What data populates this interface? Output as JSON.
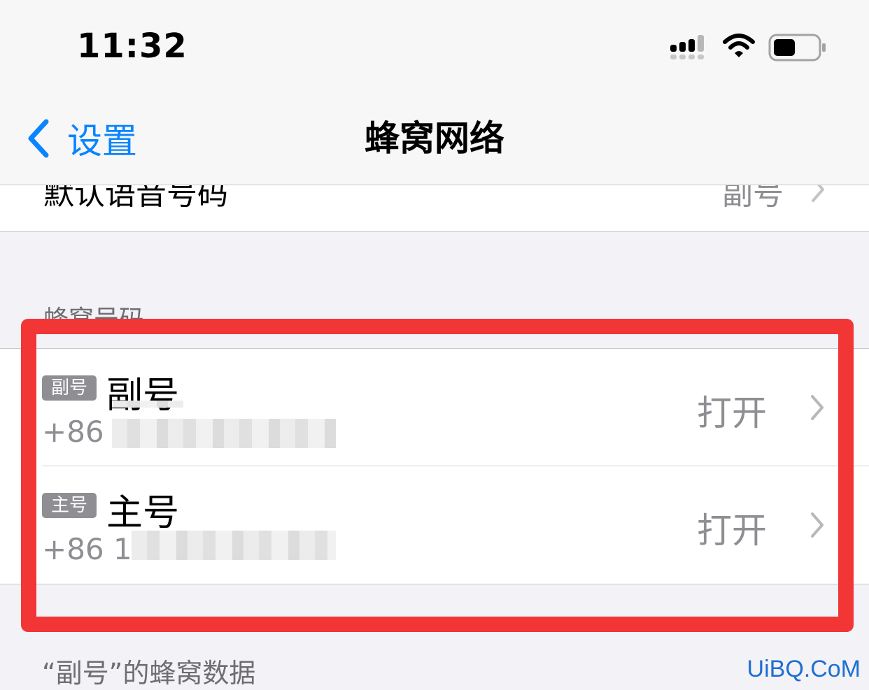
{
  "status_bar": {
    "time": "11:32",
    "icons": [
      "signal-icon",
      "wifi-icon",
      "battery-icon"
    ]
  },
  "nav": {
    "back_label": "设置",
    "title": "蜂窝网络"
  },
  "partial_row": {
    "label": "默认语音号码",
    "value": "副号"
  },
  "section": {
    "header": "蜂窝号码",
    "lines": [
      {
        "badge": "副号",
        "name": "副号",
        "number_prefix": "+86",
        "status": "打开"
      },
      {
        "badge": "主号",
        "name": "主号",
        "number_prefix": "+86 18",
        "status": "打开"
      }
    ]
  },
  "footer": {
    "header": "“副号”的蜂窝数据"
  },
  "watermark": "UiBQ.CoM",
  "colors": {
    "accent": "#0a84ff",
    "highlight": "#f23636",
    "secondary_text": "#8e8e93",
    "background": "#f2f2f7"
  }
}
